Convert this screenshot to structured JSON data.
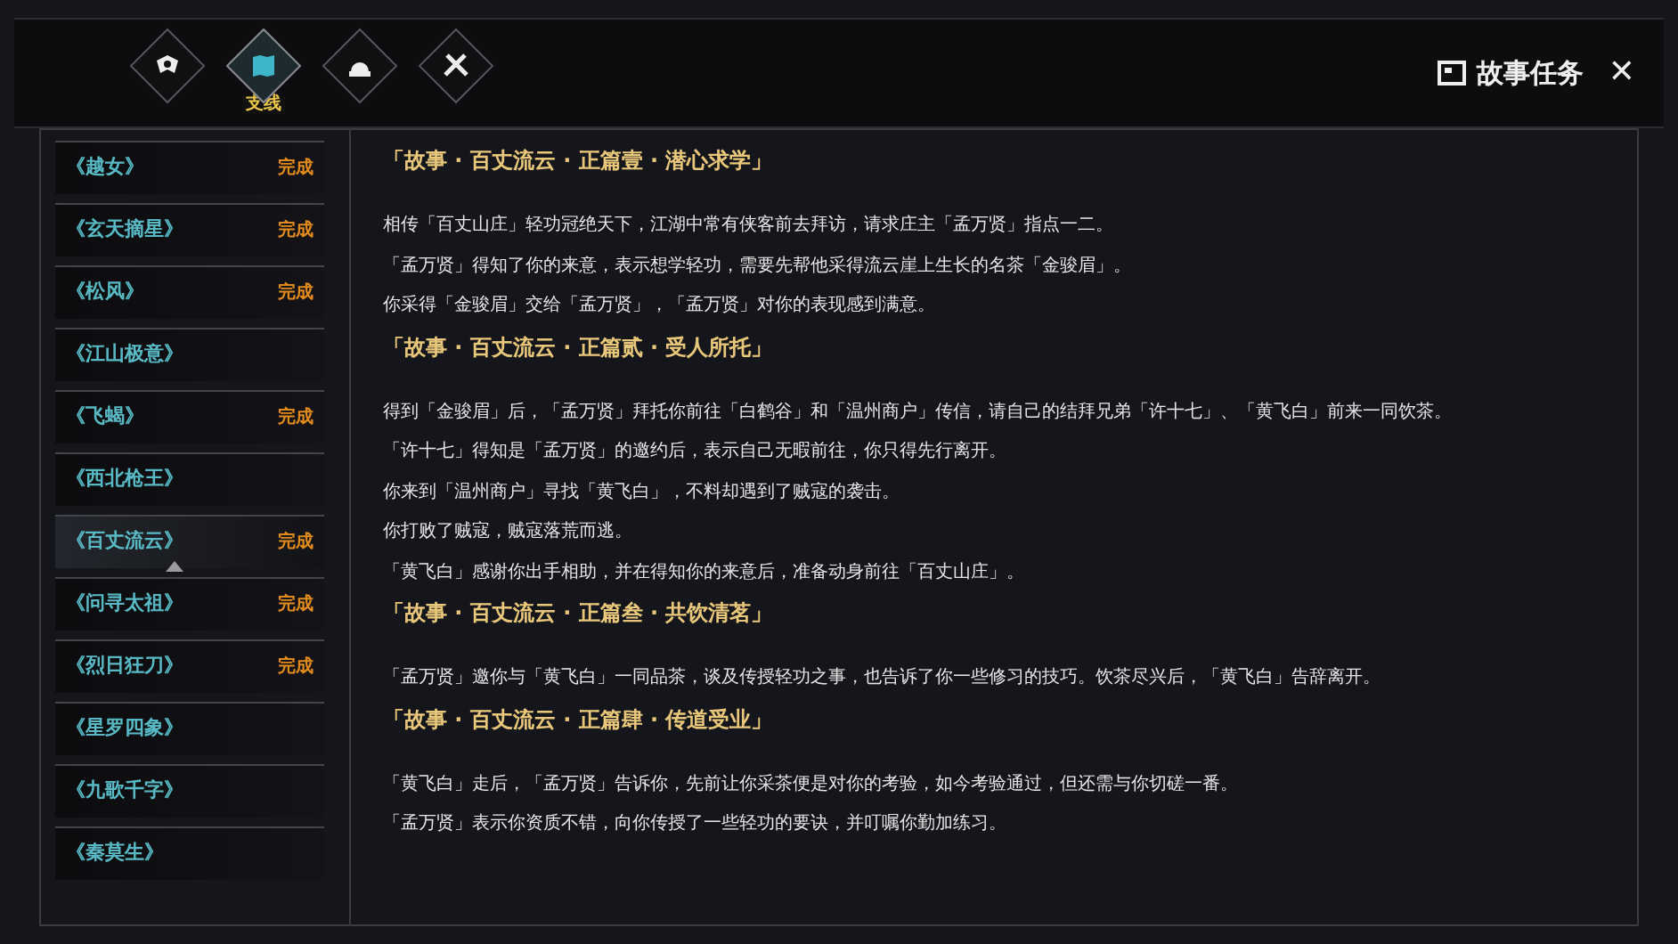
{
  "tabs": [
    {
      "selected": false
    },
    {
      "selected": true,
      "label": "支线"
    },
    {
      "selected": false
    },
    {
      "selected": false
    }
  ],
  "header": {
    "title": "故事任务",
    "close": "✕"
  },
  "quests": [
    {
      "name": "《越女》",
      "status": "完成",
      "selected": false
    },
    {
      "name": "《玄天摘星》",
      "status": "完成",
      "selected": false
    },
    {
      "name": "《松风》",
      "status": "完成",
      "selected": false
    },
    {
      "name": "《江山极意》",
      "selected": false
    },
    {
      "name": "《飞蝎》",
      "status": "完成",
      "selected": false
    },
    {
      "name": "《西北枪王》",
      "selected": false
    },
    {
      "name": "《百丈流云》",
      "status": "完成",
      "selected": true
    },
    {
      "name": "《问寻太祖》",
      "status": "完成",
      "selected": false
    },
    {
      "name": "《烈日狂刀》",
      "status": "完成",
      "selected": false
    },
    {
      "name": "《星罗四象》",
      "selected": false
    },
    {
      "name": "《九歌千字》",
      "selected": false
    },
    {
      "name": "《秦莫生》",
      "selected": false
    }
  ],
  "story": [
    {
      "title": "「故事 · 百丈流云 · 正篇壹 · 潜心求学」",
      "paragraphs": [
        "相传「百丈山庄」轻功冠绝天下，江湖中常有侠客前去拜访，请求庄主「孟万贤」指点一二。",
        "「孟万贤」得知了你的来意，表示想学轻功，需要先帮他采得流云崖上生长的名茶「金骏眉」。",
        "你采得「金骏眉」交给「孟万贤」，「孟万贤」对你的表现感到满意。"
      ]
    },
    {
      "title": "「故事 · 百丈流云 · 正篇贰 · 受人所托」",
      "paragraphs": [
        "得到「金骏眉」后，「孟万贤」拜托你前往「白鹤谷」和「温州商户」传信，请自己的结拜兄弟「许十七」、「黄飞白」前来一同饮茶。",
        "「许十七」得知是「孟万贤」的邀约后，表示自己无暇前往，你只得先行离开。",
        "你来到「温州商户」寻找「黄飞白」，不料却遇到了贼寇的袭击。",
        "你打败了贼寇，贼寇落荒而逃。",
        "「黄飞白」感谢你出手相助，并在得知你的来意后，准备动身前往「百丈山庄」。"
      ]
    },
    {
      "title": "「故事 · 百丈流云 · 正篇叁 · 共饮清茗」",
      "paragraphs": [
        "「孟万贤」邀你与「黄飞白」一同品茶，谈及传授轻功之事，也告诉了你一些修习的技巧。饮茶尽兴后，「黄飞白」告辞离开。"
      ]
    },
    {
      "title": "「故事 · 百丈流云 · 正篇肆 · 传道受业」",
      "paragraphs": [
        "「黄飞白」走后，「孟万贤」告诉你，先前让你采茶便是对你的考验，如今考验通过，但还需与你切磋一番。",
        "「孟万贤」表示你资质不错，向你传授了一些轻功的要诀，并叮嘱你勤加练习。"
      ]
    }
  ]
}
